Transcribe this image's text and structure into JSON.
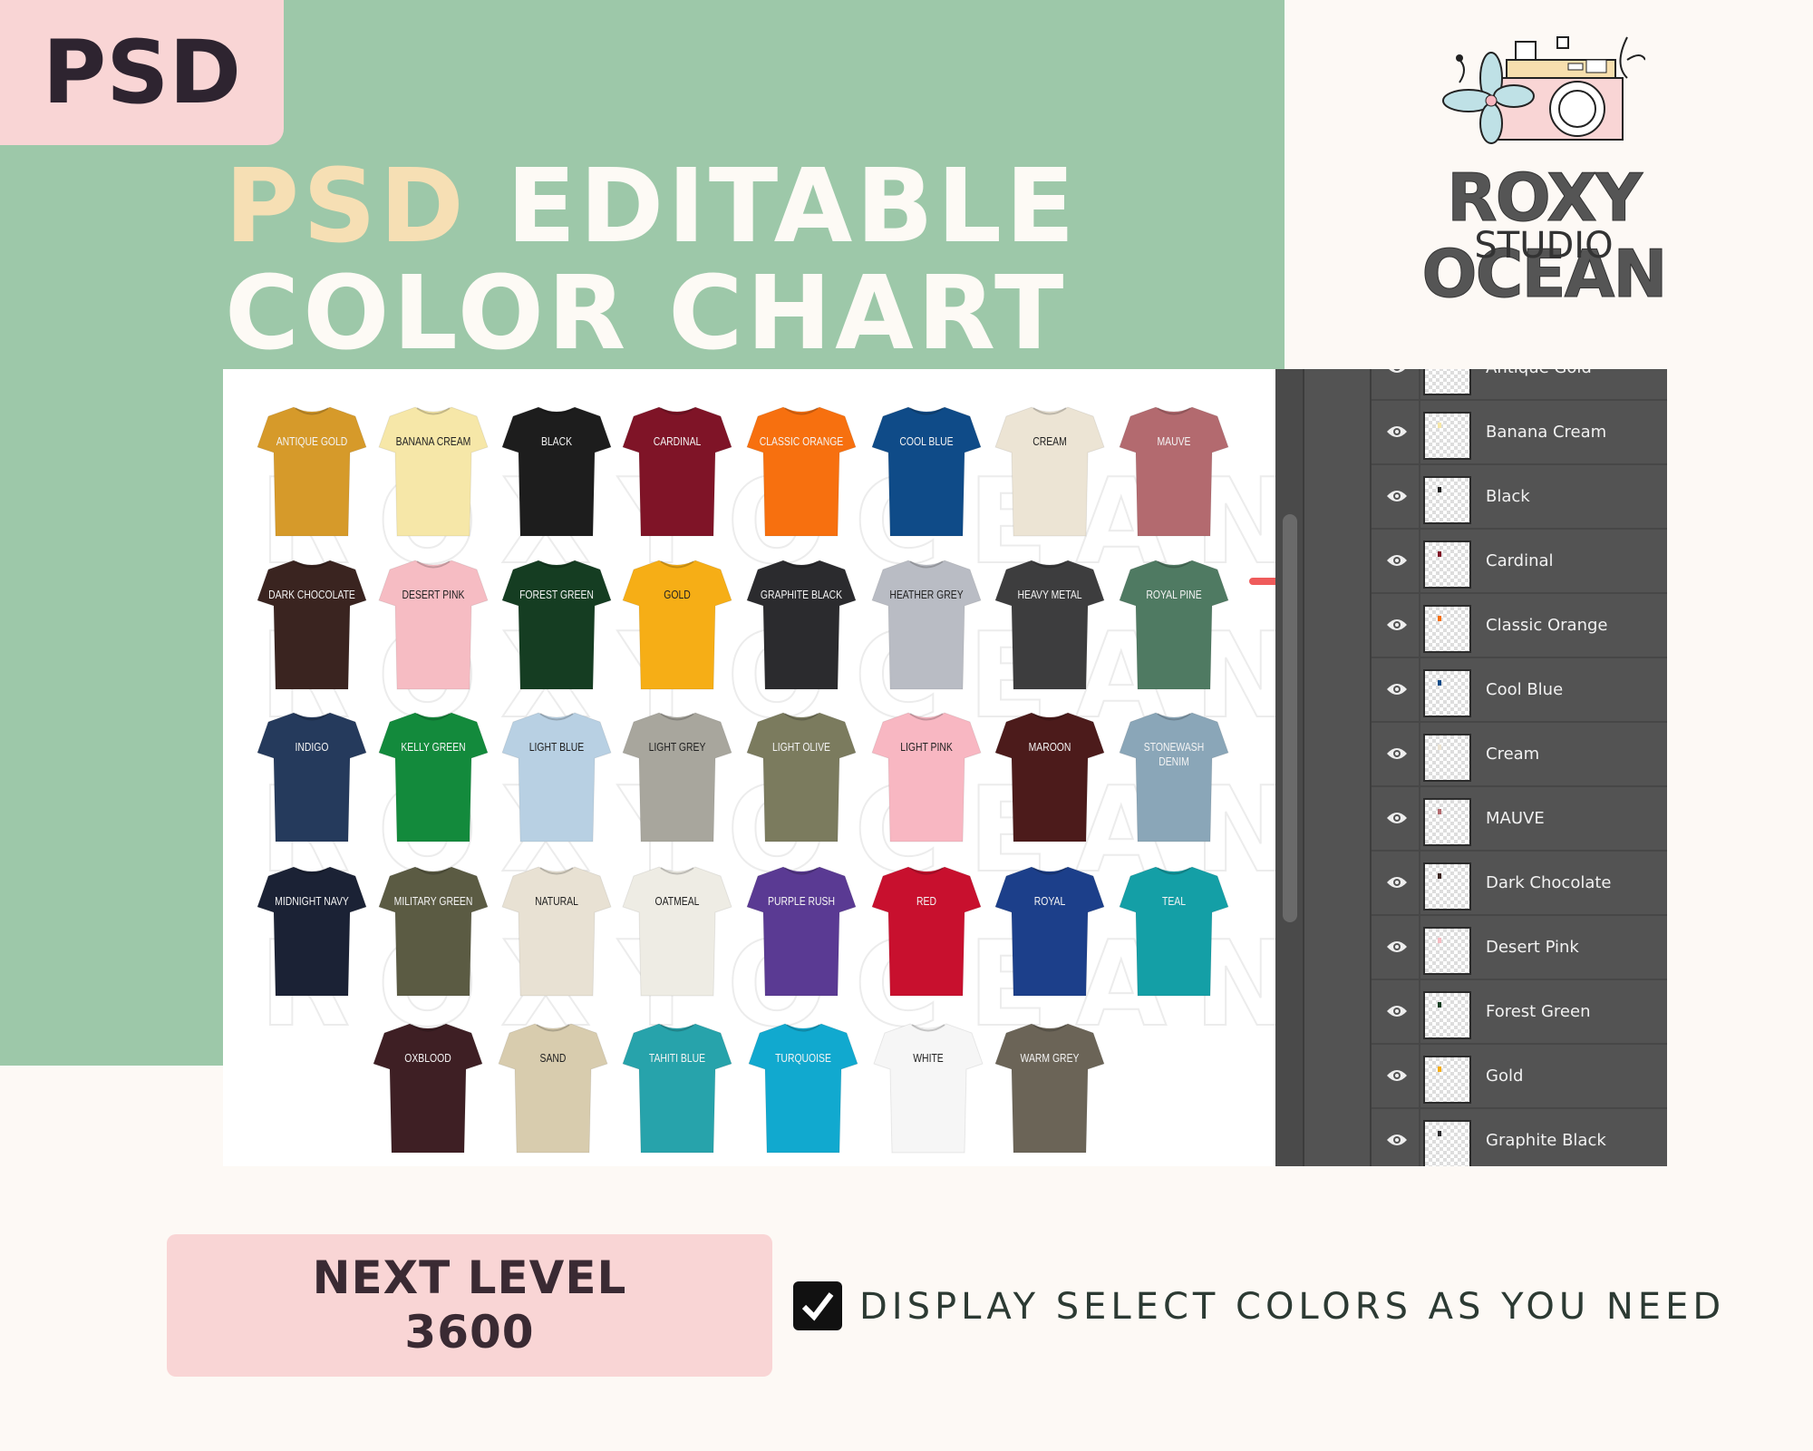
{
  "badge": "PSD",
  "title": {
    "accent": "PSD",
    "line1_rest": "EDITABLE",
    "line2": "COLOR CHART"
  },
  "brand": {
    "name": "ROXY OCEAN",
    "sub": "STUDIO",
    "watermark": "ROXYOCEAN"
  },
  "shirts": [
    [
      {
        "label": "Antique Gold",
        "color": "#d69a2a",
        "dark": false
      },
      {
        "label": "Banana Cream",
        "color": "#f6e7a8",
        "dark": true
      },
      {
        "label": "Black",
        "color": "#1d1d1d",
        "dark": false
      },
      {
        "label": "Cardinal",
        "color": "#7f1427",
        "dark": false
      },
      {
        "label": "Classic Orange",
        "color": "#f7700f",
        "dark": false
      },
      {
        "label": "Cool Blue",
        "color": "#0f4b88",
        "dark": false
      },
      {
        "label": "Cream",
        "color": "#ece4d4",
        "dark": true
      },
      {
        "label": "Mauve",
        "color": "#b36a6f",
        "dark": false
      }
    ],
    [
      {
        "label": "Dark Chocolate",
        "color": "#3a2420",
        "dark": false
      },
      {
        "label": "Desert Pink",
        "color": "#f6bcc3",
        "dark": true
      },
      {
        "label": "Forest Green",
        "color": "#153d22",
        "dark": false
      },
      {
        "label": "Gold",
        "color": "#f6ae16",
        "dark": true
      },
      {
        "label": "Graphite Black",
        "color": "#2b2b2e",
        "dark": false
      },
      {
        "label": "Heather Grey",
        "color": "#b9bcc4",
        "dark": true
      },
      {
        "label": "Heavy Metal",
        "color": "#3d3d3e",
        "dark": false
      },
      {
        "label": "Royal Pine",
        "color": "#4f7a62",
        "dark": false
      }
    ],
    [
      {
        "label": "Indigo",
        "color": "#253a5c",
        "dark": false
      },
      {
        "label": "Kelly Green",
        "color": "#138a3c",
        "dark": false
      },
      {
        "label": "Light Blue",
        "color": "#b8d0e3",
        "dark": true
      },
      {
        "label": "Light Grey",
        "color": "#a8a69d",
        "dark": true
      },
      {
        "label": "Light Olive",
        "color": "#7b7b5e",
        "dark": false
      },
      {
        "label": "Light Pink",
        "color": "#f8b7c2",
        "dark": true
      },
      {
        "label": "Maroon",
        "color": "#4c1b1b",
        "dark": false
      },
      {
        "label": "Stonewash Denim",
        "color": "#8aa6b8",
        "dark": false
      }
    ],
    [
      {
        "label": "Midnight Navy",
        "color": "#1b2235",
        "dark": false
      },
      {
        "label": "Military Green",
        "color": "#5b5b43",
        "dark": false
      },
      {
        "label": "Natural",
        "color": "#e8e1d3",
        "dark": true
      },
      {
        "label": "Oatmeal",
        "color": "#eeece4",
        "dark": true
      },
      {
        "label": "Purple Rush",
        "color": "#5a3a93",
        "dark": false
      },
      {
        "label": "Red",
        "color": "#c8102e",
        "dark": false
      },
      {
        "label": "Royal",
        "color": "#1c3f8a",
        "dark": false
      },
      {
        "label": "Teal",
        "color": "#149fa6",
        "dark": false
      }
    ],
    [
      {
        "label": "Oxblood",
        "color": "#3e1f24",
        "dark": false
      },
      {
        "label": "Sand",
        "color": "#d8ccae",
        "dark": true
      },
      {
        "label": "Tahiti Blue",
        "color": "#27a3ab",
        "dark": false
      },
      {
        "label": "Turquoise",
        "color": "#11a9cf",
        "dark": false
      },
      {
        "label": "White",
        "color": "#f6f6f6",
        "dark": true
      },
      {
        "label": "Warm Grey",
        "color": "#6b6457",
        "dark": false
      }
    ]
  ],
  "layers": [
    {
      "name": "Antique Gold",
      "dot": "#d69a2a"
    },
    {
      "name": "Banana Cream",
      "dot": "#f6e7a8"
    },
    {
      "name": "Black",
      "dot": "#1d1d1d"
    },
    {
      "name": "Cardinal",
      "dot": "#7f1427"
    },
    {
      "name": "Classic Orange",
      "dot": "#f7700f"
    },
    {
      "name": "Cool Blue",
      "dot": "#0f4b88"
    },
    {
      "name": "Cream",
      "dot": "#ece4d4"
    },
    {
      "name": "MAUVE",
      "dot": "#b36a6f"
    },
    {
      "name": "Dark Chocolate",
      "dot": "#3a2420"
    },
    {
      "name": "Desert Pink",
      "dot": "#f6bcc3"
    },
    {
      "name": "Forest Green",
      "dot": "#153d22"
    },
    {
      "name": "Gold",
      "dot": "#f6ae16"
    },
    {
      "name": "Graphite Black",
      "dot": "#2b2b2e"
    }
  ],
  "product": {
    "line1": "NEXT LEVEL",
    "line2": "3600"
  },
  "display_note": {
    "checked": true,
    "text": "DISPLAY SELECT COLORS AS YOU NEED"
  },
  "colors": {
    "green": "#9dc8a9",
    "pink": "#f9d5d5",
    "arrow": "#ef5b5b",
    "panel": "#535353"
  }
}
